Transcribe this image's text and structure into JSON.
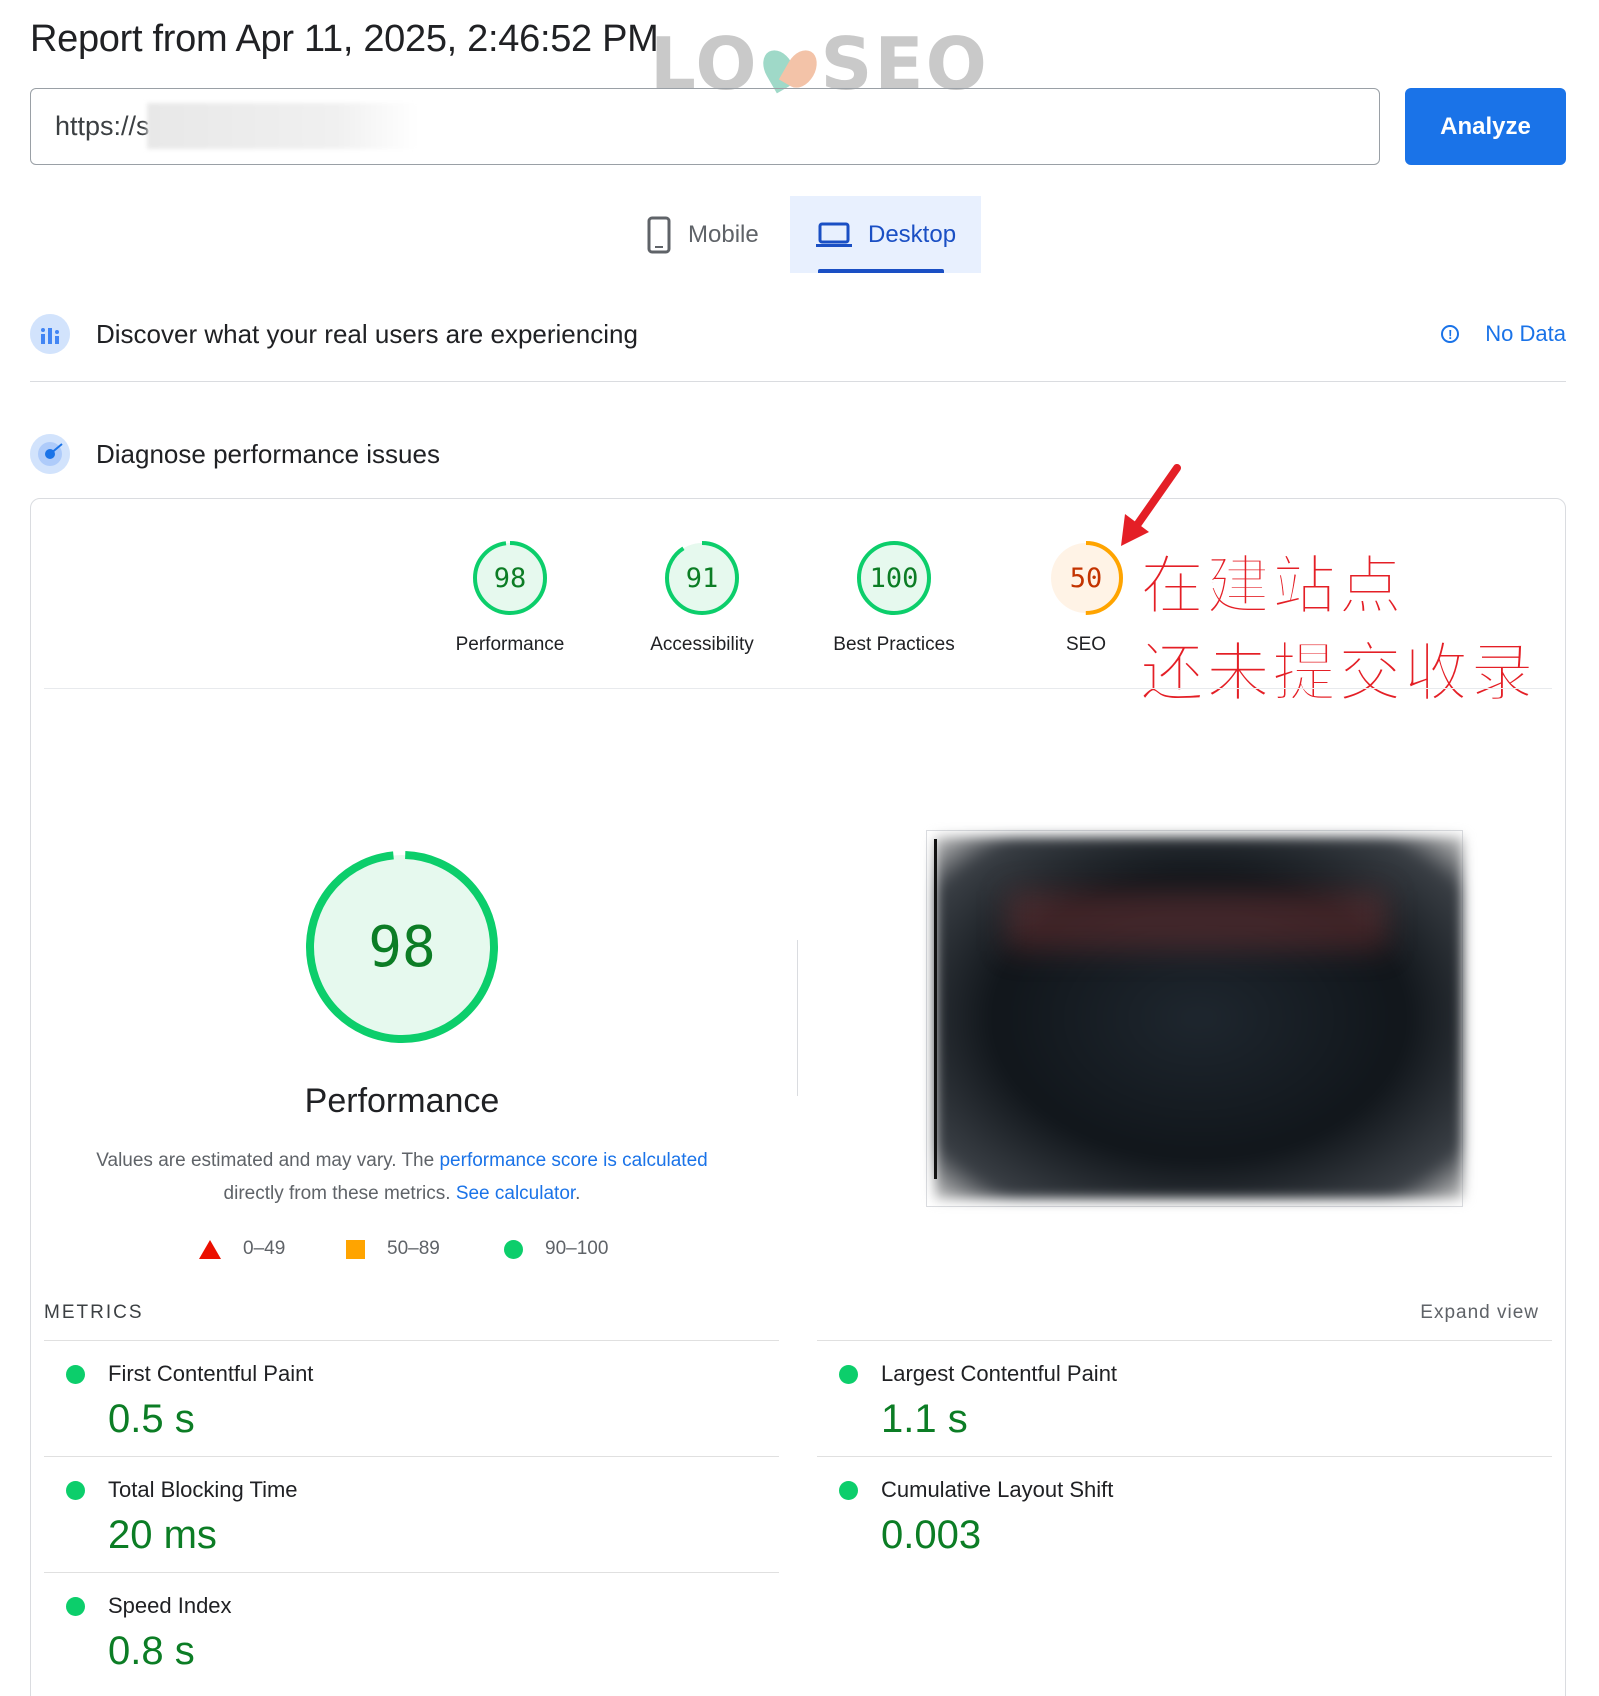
{
  "header": {
    "report_title": "Report from Apr 11, 2025, 2:46:52 PM",
    "watermark": "LOYSEO",
    "url_value": "https://s",
    "analyze_label": "Analyze"
  },
  "tabs": [
    {
      "label": "Mobile",
      "selected": false
    },
    {
      "label": "Desktop",
      "selected": true
    }
  ],
  "sections": {
    "real_users": {
      "title": "Discover what your real users are experiencing",
      "status": "No Data"
    },
    "diagnose": {
      "title": "Diagnose performance issues"
    }
  },
  "scores": [
    {
      "value": "98",
      "label": "Performance",
      "color": "#0cce6b"
    },
    {
      "value": "91",
      "label": "Accessibility",
      "color": "#0cce6b"
    },
    {
      "value": "100",
      "label": "Best Practices",
      "color": "#0cce6b"
    },
    {
      "value": "50",
      "label": "SEO",
      "color": "#ffa400"
    }
  ],
  "annotation": {
    "line1": "在建站点",
    "line2": "还未提交收录",
    "color": "#e41f26"
  },
  "performance": {
    "score": "98",
    "title": "Performance",
    "estimate_text_1": "Values are estimated and may vary. The ",
    "estimate_link_1": "performance score is calculated",
    "estimate_text_2": "directly from these metrics. ",
    "estimate_link_2": "See calculator",
    "estimate_text_3": "."
  },
  "legend": [
    {
      "range": "0–49",
      "shape": "triangle",
      "color": "#eb0f00"
    },
    {
      "range": "50–89",
      "shape": "square",
      "color": "#ffa400"
    },
    {
      "range": "90–100",
      "shape": "circle",
      "color": "#0cce6b"
    }
  ],
  "metrics": {
    "heading": "METRICS",
    "expand_label": "Expand view",
    "items": [
      {
        "name": "First Contentful Paint",
        "value": "0.5 s"
      },
      {
        "name": "Largest Contentful Paint",
        "value": "1.1 s"
      },
      {
        "name": "Total Blocking Time",
        "value": "20 ms"
      },
      {
        "name": "Cumulative Layout Shift",
        "value": "0.003"
      },
      {
        "name": "Speed Index",
        "value": "0.8 s"
      }
    ]
  }
}
